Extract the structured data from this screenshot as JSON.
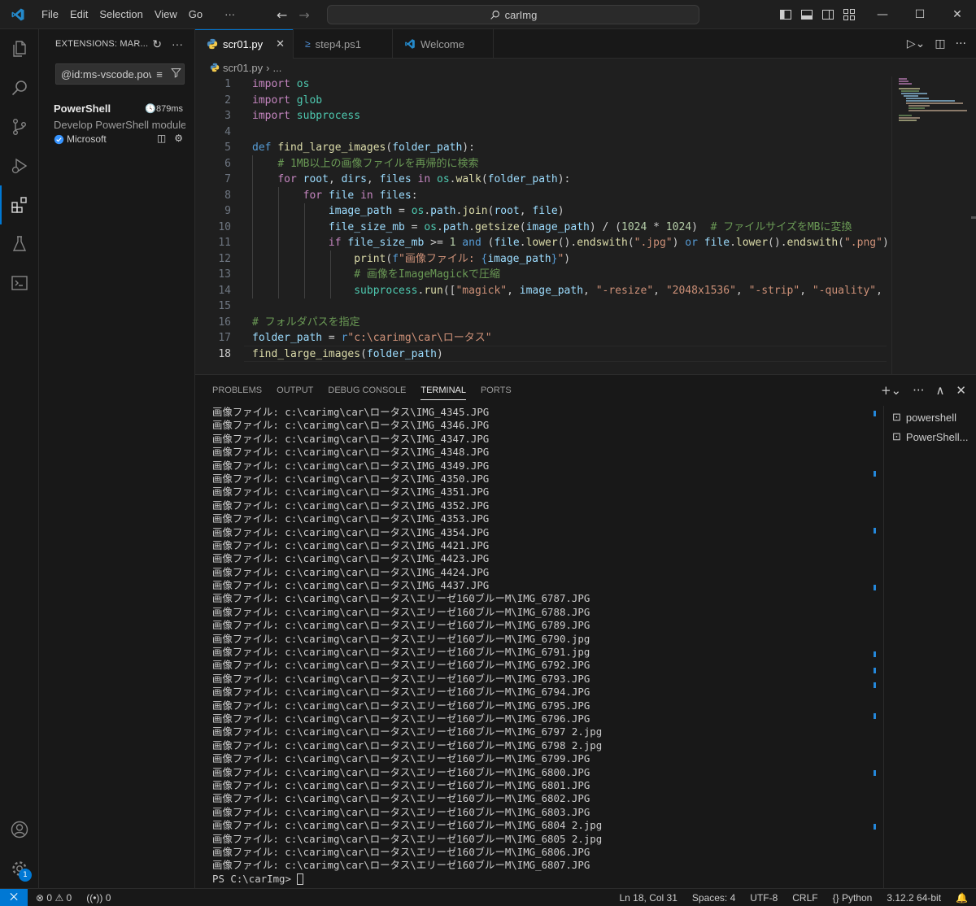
{
  "titlebar": {
    "menu": [
      "File",
      "Edit",
      "Selection",
      "View",
      "Go",
      "···"
    ],
    "search_text": "carImg"
  },
  "sidebar": {
    "title": "EXTENSIONS: MAR...",
    "search_value": "@id:ms-vscode.powershell",
    "extension": {
      "name": "PowerShell",
      "time": "879ms",
      "description": "Develop PowerShell modules, commands and scripts",
      "publisher": "Microsoft"
    }
  },
  "tabs": [
    {
      "label": "scr01.py",
      "icon": "python-icon"
    },
    {
      "label": "step4.ps1",
      "icon": "powershell-icon"
    },
    {
      "label": "Welcome",
      "icon": "vscode-icon"
    }
  ],
  "breadcrumb": {
    "file": "scr01.py",
    "rest": "..."
  },
  "editor": {
    "current_line": 18,
    "line_numbers": [
      "1",
      "2",
      "3",
      "4",
      "5",
      "6",
      "7",
      "8",
      "9",
      "10",
      "11",
      "12",
      "13",
      "14",
      "15",
      "16",
      "17",
      "18"
    ]
  },
  "panel": {
    "tabs": [
      "PROBLEMS",
      "OUTPUT",
      "DEBUG CONSOLE",
      "TERMINAL",
      "PORTS"
    ],
    "active_tab": "TERMINAL",
    "terminal_lines": [
      "画像ファイル: c:\\carimg\\car\\ロータス\\IMG_4345.JPG",
      "画像ファイル: c:\\carimg\\car\\ロータス\\IMG_4346.JPG",
      "画像ファイル: c:\\carimg\\car\\ロータス\\IMG_4347.JPG",
      "画像ファイル: c:\\carimg\\car\\ロータス\\IMG_4348.JPG",
      "画像ファイル: c:\\carimg\\car\\ロータス\\IMG_4349.JPG",
      "画像ファイル: c:\\carimg\\car\\ロータス\\IMG_4350.JPG",
      "画像ファイル: c:\\carimg\\car\\ロータス\\IMG_4351.JPG",
      "画像ファイル: c:\\carimg\\car\\ロータス\\IMG_4352.JPG",
      "画像ファイル: c:\\carimg\\car\\ロータス\\IMG_4353.JPG",
      "画像ファイル: c:\\carimg\\car\\ロータス\\IMG_4354.JPG",
      "画像ファイル: c:\\carimg\\car\\ロータス\\IMG_4421.JPG",
      "画像ファイル: c:\\carimg\\car\\ロータス\\IMG_4423.JPG",
      "画像ファイル: c:\\carimg\\car\\ロータス\\IMG_4424.JPG",
      "画像ファイル: c:\\carimg\\car\\ロータス\\IMG_4437.JPG",
      "画像ファイル: c:\\carimg\\car\\ロータス\\エリーゼ160ブルーM\\IMG_6787.JPG",
      "画像ファイル: c:\\carimg\\car\\ロータス\\エリーゼ160ブルーM\\IMG_6788.JPG",
      "画像ファイル: c:\\carimg\\car\\ロータス\\エリーゼ160ブルーM\\IMG_6789.JPG",
      "画像ファイル: c:\\carimg\\car\\ロータス\\エリーゼ160ブルーM\\IMG_6790.jpg",
      "画像ファイル: c:\\carimg\\car\\ロータス\\エリーゼ160ブルーM\\IMG_6791.jpg",
      "画像ファイル: c:\\carimg\\car\\ロータス\\エリーゼ160ブルーM\\IMG_6792.JPG",
      "画像ファイル: c:\\carimg\\car\\ロータス\\エリーゼ160ブルーM\\IMG_6793.JPG",
      "画像ファイル: c:\\carimg\\car\\ロータス\\エリーゼ160ブルーM\\IMG_6794.JPG",
      "画像ファイル: c:\\carimg\\car\\ロータス\\エリーゼ160ブルーM\\IMG_6795.JPG",
      "画像ファイル: c:\\carimg\\car\\ロータス\\エリーゼ160ブルーM\\IMG_6796.JPG",
      "画像ファイル: c:\\carimg\\car\\ロータス\\エリーゼ160ブルーM\\IMG_6797 2.jpg",
      "画像ファイル: c:\\carimg\\car\\ロータス\\エリーゼ160ブルーM\\IMG_6798 2.jpg",
      "画像ファイル: c:\\carimg\\car\\ロータス\\エリーゼ160ブルーM\\IMG_6799.JPG",
      "画像ファイル: c:\\carimg\\car\\ロータス\\エリーゼ160ブルーM\\IMG_6800.JPG",
      "画像ファイル: c:\\carimg\\car\\ロータス\\エリーゼ160ブルーM\\IMG_6801.JPG",
      "画像ファイル: c:\\carimg\\car\\ロータス\\エリーゼ160ブルーM\\IMG_6802.JPG",
      "画像ファイル: c:\\carimg\\car\\ロータス\\エリーゼ160ブルーM\\IMG_6803.JPG",
      "画像ファイル: c:\\carimg\\car\\ロータス\\エリーゼ160ブルーM\\IMG_6804 2.jpg",
      "画像ファイル: c:\\carimg\\car\\ロータス\\エリーゼ160ブルーM\\IMG_6805 2.jpg",
      "画像ファイル: c:\\carimg\\car\\ロータス\\エリーゼ160ブルーM\\IMG_6806.JPG",
      "画像ファイル: c:\\carimg\\car\\ロータス\\エリーゼ160ブルーM\\IMG_6807.JPG"
    ],
    "prompt": "PS C:\\carImg> ",
    "terminal_list": [
      "powershell",
      "PowerShell..."
    ]
  },
  "statusbar": {
    "errors": "0",
    "warnings": "0",
    "ports": "0",
    "position": "Ln 18, Col 31",
    "spaces": "Spaces: 4",
    "encoding": "UTF-8",
    "eol": "CRLF",
    "language": "Python",
    "interpreter": "3.12.2 64-bit"
  },
  "activity_badge": "1",
  "colors": {
    "accent": "#0078d4",
    "keyword": "#c586c0",
    "keyword_blue": "#569cd6",
    "function": "#dcdcaa",
    "variable": "#9cdcfe",
    "string": "#ce9178",
    "number": "#b5cea8",
    "comment": "#6a9955",
    "module": "#4ec9b0"
  }
}
